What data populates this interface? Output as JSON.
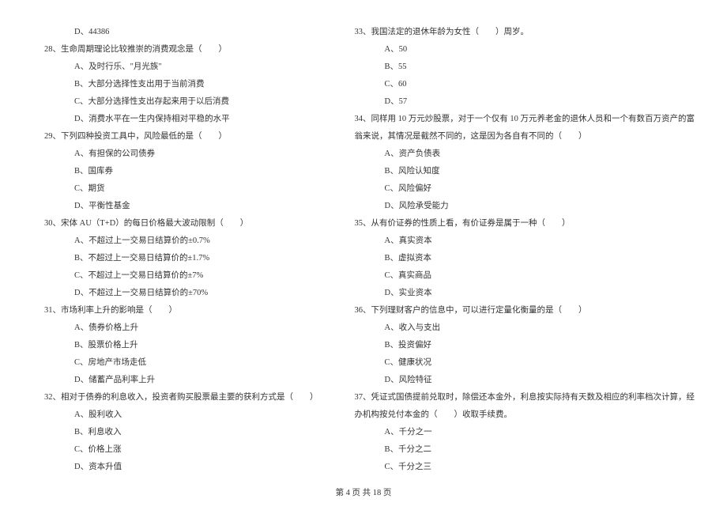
{
  "left_column": [
    {
      "type": "option",
      "text": "D、44386"
    },
    {
      "type": "question",
      "text": "28、生命周期理论比较推崇的消费观念是（　　）"
    },
    {
      "type": "option",
      "text": "A、及时行乐、\"月光族\""
    },
    {
      "type": "option",
      "text": "B、大部分选择性支出用于当前消费"
    },
    {
      "type": "option",
      "text": "C、大部分选择性支出存起来用于以后消费"
    },
    {
      "type": "option",
      "text": "D、消费水平在一生内保持相对平稳的水平"
    },
    {
      "type": "question",
      "text": "29、下列四种投资工具中，风险最低的是（　　）"
    },
    {
      "type": "option",
      "text": "A、有担保的公司债券"
    },
    {
      "type": "option",
      "text": "B、国库券"
    },
    {
      "type": "option",
      "text": "C、期货"
    },
    {
      "type": "option",
      "text": "D、平衡性基金"
    },
    {
      "type": "question",
      "text": "30、宋体 AU（T+D）的每日价格最大波动限制（　　）"
    },
    {
      "type": "option",
      "text": "A、不超过上一交易日结算价的±0.7%"
    },
    {
      "type": "option",
      "text": "B、不超过上一交易日结算价的±1.7%"
    },
    {
      "type": "option",
      "text": "C、不超过上一交易日结算价的±7%"
    },
    {
      "type": "option",
      "text": "D、不超过上一交易日结算价的±70%"
    },
    {
      "type": "question",
      "text": "31、市场利率上升的影响是（　　）"
    },
    {
      "type": "option",
      "text": "A、债券价格上升"
    },
    {
      "type": "option",
      "text": "B、股票价格上升"
    },
    {
      "type": "option",
      "text": "C、房地产市场走低"
    },
    {
      "type": "option",
      "text": "D、储蓄产品利率上升"
    },
    {
      "type": "question",
      "text": "32、相对于债券的利息收入，投资者购买股票最主要的获利方式是（　　）"
    },
    {
      "type": "option",
      "text": "A、股利收入"
    },
    {
      "type": "option",
      "text": "B、利息收入"
    },
    {
      "type": "option",
      "text": "C、价格上涨"
    },
    {
      "type": "option",
      "text": "D、资本升值"
    }
  ],
  "right_column": [
    {
      "type": "question",
      "text": "33、我国法定的退休年龄为女性（　　）周岁。"
    },
    {
      "type": "option",
      "text": "A、50"
    },
    {
      "type": "option",
      "text": "B、55"
    },
    {
      "type": "option",
      "text": "C、60"
    },
    {
      "type": "option",
      "text": "D、57"
    },
    {
      "type": "question",
      "text": "34、同样用 10 万元炒股票，对于一个仅有 10 万元养老金的退休人员和一个有数百万资产的富"
    },
    {
      "type": "question",
      "text": "翁来说，其情况是截然不同的，这是因为各自有不同的（　　）"
    },
    {
      "type": "option",
      "text": "A、资产负债表"
    },
    {
      "type": "option",
      "text": "B、风险认知度"
    },
    {
      "type": "option",
      "text": "C、风险偏好"
    },
    {
      "type": "option",
      "text": "D、风险承受能力"
    },
    {
      "type": "question",
      "text": "35、从有价证券的性质上看，有价证券是属于一种（　　）"
    },
    {
      "type": "option",
      "text": "A、真实资本"
    },
    {
      "type": "option",
      "text": "B、虚拟资本"
    },
    {
      "type": "option",
      "text": "C、真实商品"
    },
    {
      "type": "option",
      "text": "D、实业资本"
    },
    {
      "type": "question",
      "text": "36、下列理财客户的信息中，可以进行定量化衡量的是（　　）"
    },
    {
      "type": "option",
      "text": "A、收入与支出"
    },
    {
      "type": "option",
      "text": "B、投资偏好"
    },
    {
      "type": "option",
      "text": "C、健康状况"
    },
    {
      "type": "option",
      "text": "D、风险特征"
    },
    {
      "type": "question",
      "text": "37、凭证式国债提前兑取时，除偿还本金外，利息按实际持有天数及相应的利率档次计算，经"
    },
    {
      "type": "question",
      "text": "办机构按兑付本金的（　　）收取手续费。"
    },
    {
      "type": "option",
      "text": "A、千分之一"
    },
    {
      "type": "option",
      "text": "B、千分之二"
    },
    {
      "type": "option",
      "text": "C、千分之三"
    }
  ],
  "footer": "第 4 页 共 18 页"
}
